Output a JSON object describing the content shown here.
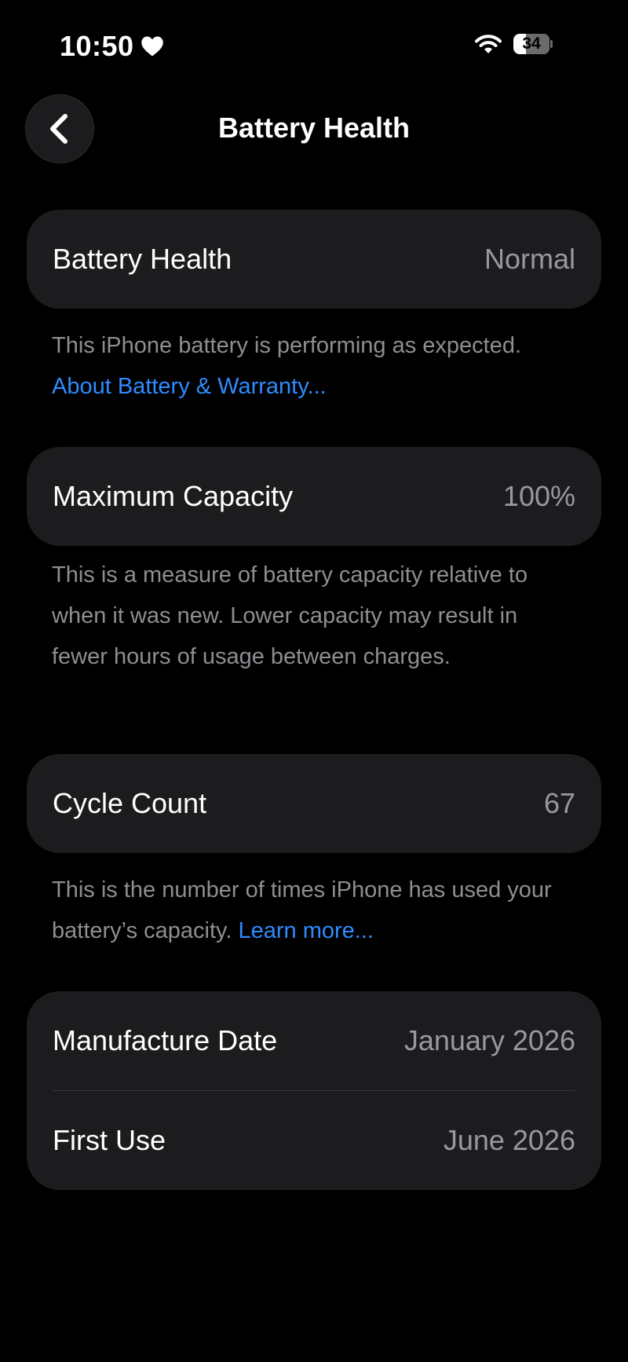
{
  "status_bar": {
    "time": "10:50",
    "battery_level": "34",
    "battery_fraction": 0.34
  },
  "nav": {
    "back_icon": "chevron-left-icon",
    "title": "Battery Health"
  },
  "battery_health": {
    "label": "Battery Health",
    "value": "Normal",
    "description": "This iPhone battery is performing as expected.",
    "link": "About Battery & Warranty..."
  },
  "maximum_capacity": {
    "label": "Maximum Capacity",
    "value": "100%",
    "description": "This is a measure of battery capacity relative to when it was new. Lower capacity may result in fewer hours of usage between charges."
  },
  "cycle_count": {
    "label": "Cycle Count",
    "value": "67",
    "description": "This is the number of times iPhone has used your battery’s capacity.",
    "link": "Learn more..."
  },
  "dates": {
    "manufacture_label": "Manufacture Date",
    "manufacture_value": "January 2026",
    "first_use_label": "First Use",
    "first_use_value": "June 2026"
  },
  "colors": {
    "background": "#000000",
    "card": "#1c1c1e",
    "secondary_text": "#98989f",
    "link": "#2f8bff"
  }
}
